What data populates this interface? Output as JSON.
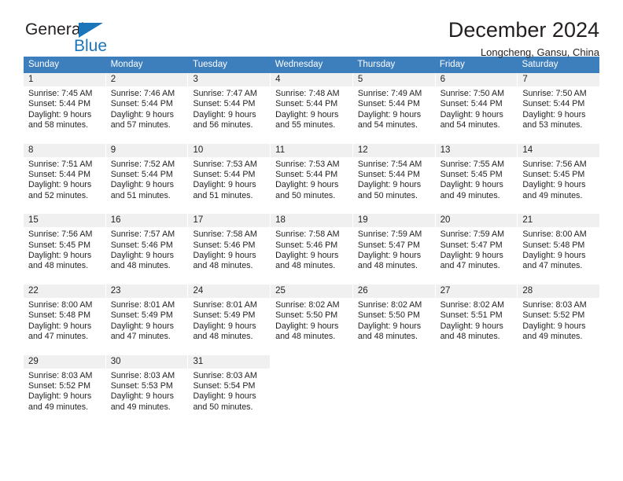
{
  "brand": {
    "word1": "General",
    "word2": "Blue",
    "triangle_color": "#1b75bb",
    "logo_icon": "triangle-icon"
  },
  "header": {
    "title": "December 2024",
    "subtitle": "Longcheng, Gansu, China"
  },
  "theme": {
    "header_bg": "#3d7ebd",
    "daynum_bg": "#f0f0f0",
    "text": "#231f20",
    "accent": "#1b75bb"
  },
  "calendar": {
    "weekday_headers": [
      "Sunday",
      "Monday",
      "Tuesday",
      "Wednesday",
      "Thursday",
      "Friday",
      "Saturday"
    ],
    "weeks": [
      [
        {
          "day": "1",
          "lines": [
            "Sunrise: 7:45 AM",
            "Sunset: 5:44 PM",
            "Daylight: 9 hours",
            "and 58 minutes."
          ]
        },
        {
          "day": "2",
          "lines": [
            "Sunrise: 7:46 AM",
            "Sunset: 5:44 PM",
            "Daylight: 9 hours",
            "and 57 minutes."
          ]
        },
        {
          "day": "3",
          "lines": [
            "Sunrise: 7:47 AM",
            "Sunset: 5:44 PM",
            "Daylight: 9 hours",
            "and 56 minutes."
          ]
        },
        {
          "day": "4",
          "lines": [
            "Sunrise: 7:48 AM",
            "Sunset: 5:44 PM",
            "Daylight: 9 hours",
            "and 55 minutes."
          ]
        },
        {
          "day": "5",
          "lines": [
            "Sunrise: 7:49 AM",
            "Sunset: 5:44 PM",
            "Daylight: 9 hours",
            "and 54 minutes."
          ]
        },
        {
          "day": "6",
          "lines": [
            "Sunrise: 7:50 AM",
            "Sunset: 5:44 PM",
            "Daylight: 9 hours",
            "and 54 minutes."
          ]
        },
        {
          "day": "7",
          "lines": [
            "Sunrise: 7:50 AM",
            "Sunset: 5:44 PM",
            "Daylight: 9 hours",
            "and 53 minutes."
          ]
        }
      ],
      [
        {
          "day": "8",
          "lines": [
            "Sunrise: 7:51 AM",
            "Sunset: 5:44 PM",
            "Daylight: 9 hours",
            "and 52 minutes."
          ]
        },
        {
          "day": "9",
          "lines": [
            "Sunrise: 7:52 AM",
            "Sunset: 5:44 PM",
            "Daylight: 9 hours",
            "and 51 minutes."
          ]
        },
        {
          "day": "10",
          "lines": [
            "Sunrise: 7:53 AM",
            "Sunset: 5:44 PM",
            "Daylight: 9 hours",
            "and 51 minutes."
          ]
        },
        {
          "day": "11",
          "lines": [
            "Sunrise: 7:53 AM",
            "Sunset: 5:44 PM",
            "Daylight: 9 hours",
            "and 50 minutes."
          ]
        },
        {
          "day": "12",
          "lines": [
            "Sunrise: 7:54 AM",
            "Sunset: 5:44 PM",
            "Daylight: 9 hours",
            "and 50 minutes."
          ]
        },
        {
          "day": "13",
          "lines": [
            "Sunrise: 7:55 AM",
            "Sunset: 5:45 PM",
            "Daylight: 9 hours",
            "and 49 minutes."
          ]
        },
        {
          "day": "14",
          "lines": [
            "Sunrise: 7:56 AM",
            "Sunset: 5:45 PM",
            "Daylight: 9 hours",
            "and 49 minutes."
          ]
        }
      ],
      [
        {
          "day": "15",
          "lines": [
            "Sunrise: 7:56 AM",
            "Sunset: 5:45 PM",
            "Daylight: 9 hours",
            "and 48 minutes."
          ]
        },
        {
          "day": "16",
          "lines": [
            "Sunrise: 7:57 AM",
            "Sunset: 5:46 PM",
            "Daylight: 9 hours",
            "and 48 minutes."
          ]
        },
        {
          "day": "17",
          "lines": [
            "Sunrise: 7:58 AM",
            "Sunset: 5:46 PM",
            "Daylight: 9 hours",
            "and 48 minutes."
          ]
        },
        {
          "day": "18",
          "lines": [
            "Sunrise: 7:58 AM",
            "Sunset: 5:46 PM",
            "Daylight: 9 hours",
            "and 48 minutes."
          ]
        },
        {
          "day": "19",
          "lines": [
            "Sunrise: 7:59 AM",
            "Sunset: 5:47 PM",
            "Daylight: 9 hours",
            "and 48 minutes."
          ]
        },
        {
          "day": "20",
          "lines": [
            "Sunrise: 7:59 AM",
            "Sunset: 5:47 PM",
            "Daylight: 9 hours",
            "and 47 minutes."
          ]
        },
        {
          "day": "21",
          "lines": [
            "Sunrise: 8:00 AM",
            "Sunset: 5:48 PM",
            "Daylight: 9 hours",
            "and 47 minutes."
          ]
        }
      ],
      [
        {
          "day": "22",
          "lines": [
            "Sunrise: 8:00 AM",
            "Sunset: 5:48 PM",
            "Daylight: 9 hours",
            "and 47 minutes."
          ]
        },
        {
          "day": "23",
          "lines": [
            "Sunrise: 8:01 AM",
            "Sunset: 5:49 PM",
            "Daylight: 9 hours",
            "and 47 minutes."
          ]
        },
        {
          "day": "24",
          "lines": [
            "Sunrise: 8:01 AM",
            "Sunset: 5:49 PM",
            "Daylight: 9 hours",
            "and 48 minutes."
          ]
        },
        {
          "day": "25",
          "lines": [
            "Sunrise: 8:02 AM",
            "Sunset: 5:50 PM",
            "Daylight: 9 hours",
            "and 48 minutes."
          ]
        },
        {
          "day": "26",
          "lines": [
            "Sunrise: 8:02 AM",
            "Sunset: 5:50 PM",
            "Daylight: 9 hours",
            "and 48 minutes."
          ]
        },
        {
          "day": "27",
          "lines": [
            "Sunrise: 8:02 AM",
            "Sunset: 5:51 PM",
            "Daylight: 9 hours",
            "and 48 minutes."
          ]
        },
        {
          "day": "28",
          "lines": [
            "Sunrise: 8:03 AM",
            "Sunset: 5:52 PM",
            "Daylight: 9 hours",
            "and 49 minutes."
          ]
        }
      ],
      [
        {
          "day": "29",
          "lines": [
            "Sunrise: 8:03 AM",
            "Sunset: 5:52 PM",
            "Daylight: 9 hours",
            "and 49 minutes."
          ]
        },
        {
          "day": "30",
          "lines": [
            "Sunrise: 8:03 AM",
            "Sunset: 5:53 PM",
            "Daylight: 9 hours",
            "and 49 minutes."
          ]
        },
        {
          "day": "31",
          "lines": [
            "Sunrise: 8:03 AM",
            "Sunset: 5:54 PM",
            "Daylight: 9 hours",
            "and 50 minutes."
          ]
        },
        {
          "day": "",
          "lines": [],
          "blank": true
        },
        {
          "day": "",
          "lines": [],
          "blank": true
        },
        {
          "day": "",
          "lines": [],
          "blank": true
        },
        {
          "day": "",
          "lines": [],
          "blank": true
        }
      ]
    ]
  }
}
